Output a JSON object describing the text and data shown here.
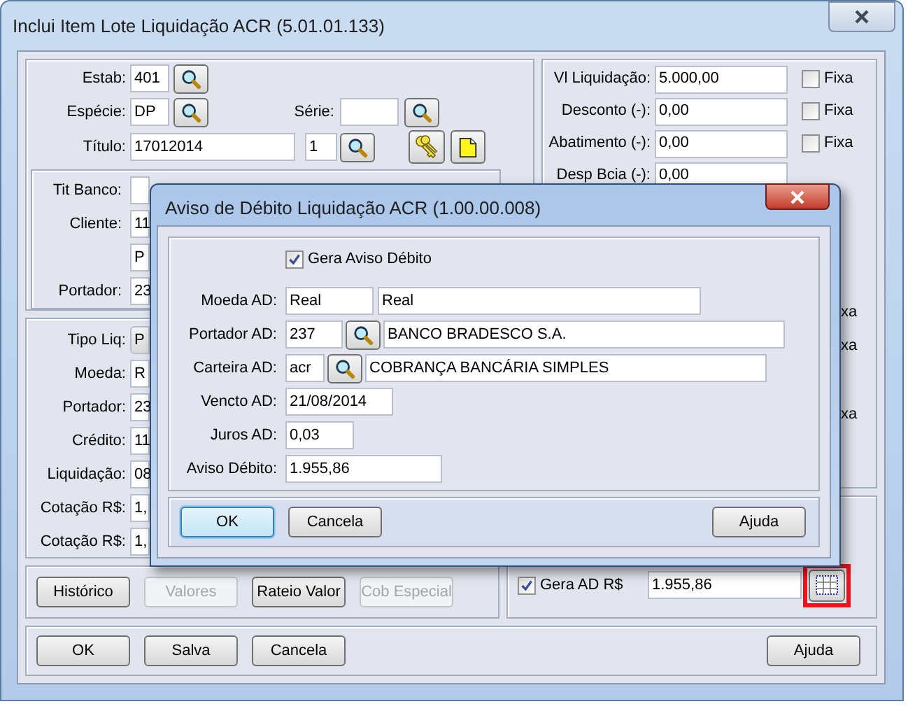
{
  "window": {
    "title": "Inclui Item Lote Liquidação ACR (5.01.01.133)"
  },
  "header": {
    "estab": {
      "label": "Estab:",
      "value": "401"
    },
    "especie": {
      "label": "Espécie:",
      "value": "DP"
    },
    "serie": {
      "label": "Série:"
    },
    "titulo": {
      "label": "Título:",
      "value": "17012014",
      "parcela": "1"
    }
  },
  "titulo_banco": [
    {
      "label": "Tit Banco:"
    },
    {
      "label": "Cliente:",
      "value": "11"
    },
    {
      "value": "P"
    },
    {
      "label": "Portador:",
      "value": "23"
    }
  ],
  "liquidacao": [
    {
      "label": "Tipo Liq:",
      "value": "P",
      "kind": "combo"
    },
    {
      "label": "Moeda:",
      "value": "R",
      "kind": "text"
    },
    {
      "label": "Portador:",
      "value": "23",
      "kind": "text"
    },
    {
      "label": "Crédito:",
      "value": "11",
      "kind": "text"
    },
    {
      "label": "Liquidação:",
      "value": "08",
      "kind": "text"
    },
    {
      "label": "Cotação R$:",
      "value": "1,",
      "kind": "text"
    },
    {
      "label": "Cotação R$:",
      "value": "1,",
      "kind": "text"
    }
  ],
  "valores": [
    {
      "label": "Vl Liquidação:",
      "value": "5.000,00",
      "fixa": {
        "label": "Fixa",
        "checked": false
      }
    },
    {
      "label": "Desconto (-):",
      "value": "0,00",
      "fixa": {
        "label": "Fixa",
        "checked": false
      }
    },
    {
      "label": "Abatimento (-):",
      "value": "0,00",
      "fixa": {
        "label": "Fixa",
        "checked": false
      }
    },
    {
      "label": "Desp Bcia (-):",
      "value": "0,00"
    }
  ],
  "covered_fixa_labels": [
    "xa",
    "xa",
    "xa"
  ],
  "gera_ad": {
    "label": "Gera AD R$",
    "checked": true,
    "value": "1.955,86"
  },
  "action_buttons": [
    {
      "label": "Histórico",
      "disabled": false
    },
    {
      "label": "Valores",
      "disabled": true
    },
    {
      "label": "Rateio Valor",
      "disabled": false
    },
    {
      "label": "Cob Especial",
      "disabled": true
    }
  ],
  "footer_buttons": [
    "OK",
    "Salva",
    "Cancela",
    "Ajuda"
  ],
  "dialog": {
    "title": "Aviso de Débito Liquidação ACR (1.00.00.008)",
    "gera": {
      "label": "Gera Aviso Débito",
      "checked": true
    },
    "fields": [
      {
        "label": "Moeda AD:",
        "value": "Real",
        "lookup": false,
        "description": "Real"
      },
      {
        "label": "Portador AD:",
        "value": "237",
        "lookup": true,
        "description": "BANCO BRADESCO S.A."
      },
      {
        "label": "Carteira AD:",
        "value": "acr",
        "lookup": true,
        "description": "COBRANÇA BANCÁRIA SIMPLES"
      },
      {
        "label": "Vencto AD:",
        "value": "21/08/2014"
      },
      {
        "label": "Juros AD:",
        "value": "0,03"
      },
      {
        "label": "Aviso Débito:",
        "value": "1.955,86"
      }
    ],
    "buttons": [
      {
        "label": "OK",
        "focused": true
      },
      {
        "label": "Cancela",
        "focused": false
      },
      {
        "label": "Ajuda",
        "focused": false
      }
    ]
  }
}
